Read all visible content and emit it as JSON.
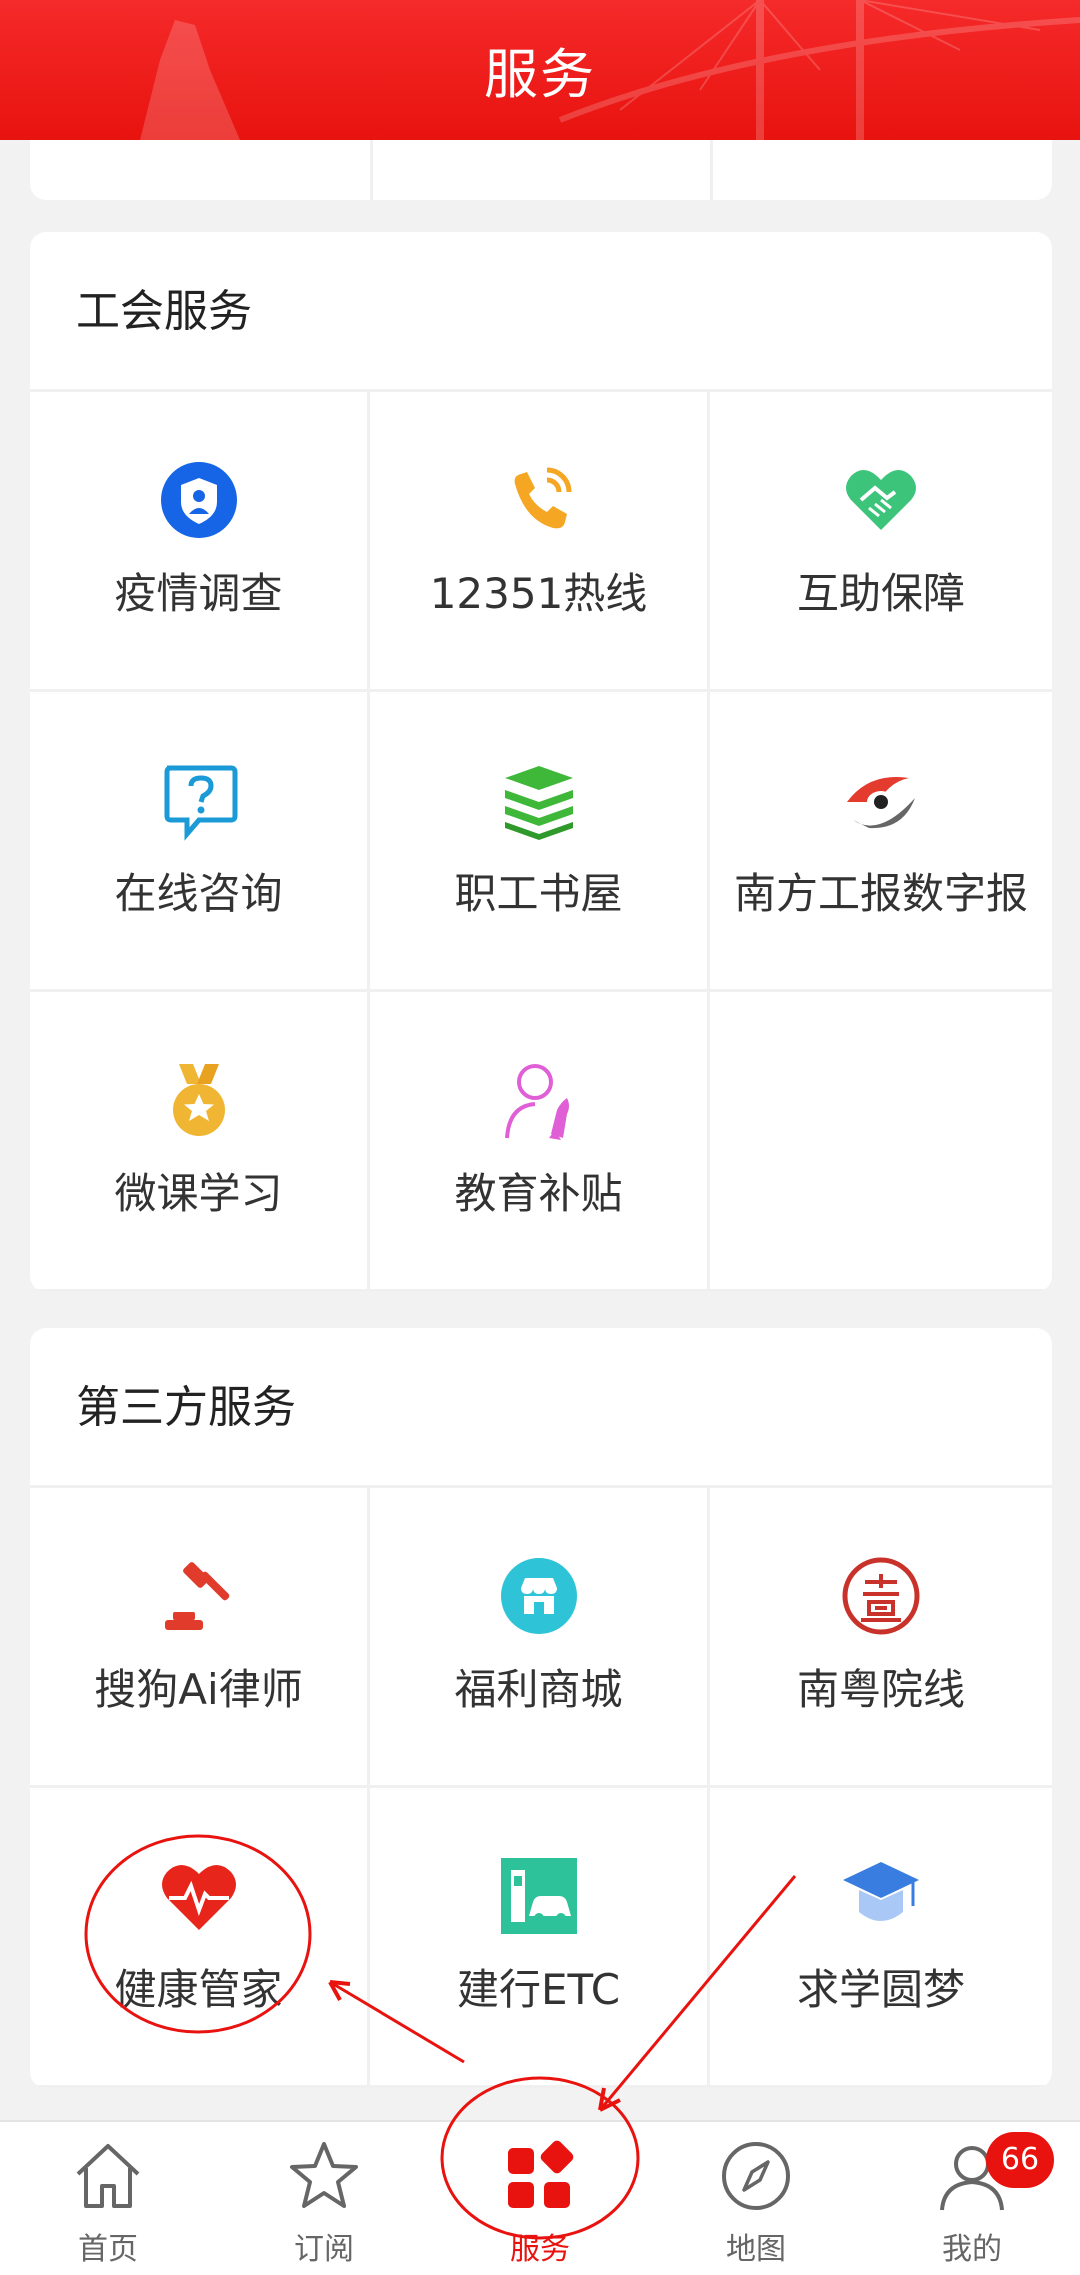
{
  "header": {
    "title": "服务"
  },
  "sections": [
    {
      "title": "工会服务",
      "items": [
        {
          "label": "疫情调查",
          "icon": "shield-person-icon"
        },
        {
          "label": "12351热线",
          "icon": "phone-hotline-icon"
        },
        {
          "label": "互助保障",
          "icon": "handshake-heart-icon"
        },
        {
          "label": "在线咨询",
          "icon": "question-bubble-icon"
        },
        {
          "label": "职工书屋",
          "icon": "book-stack-icon"
        },
        {
          "label": "南方工报数字报",
          "icon": "newspaper-logo-icon"
        },
        {
          "label": "微课学习",
          "icon": "medal-icon"
        },
        {
          "label": "教育补贴",
          "icon": "person-rocket-icon"
        }
      ]
    },
    {
      "title": "第三方服务",
      "items": [
        {
          "label": "搜狗Ai律师",
          "icon": "gavel-icon"
        },
        {
          "label": "福利商城",
          "icon": "store-icon"
        },
        {
          "label": "南粤院线",
          "icon": "seal-icon"
        },
        {
          "label": "健康管家",
          "icon": "heartbeat-icon"
        },
        {
          "label": "建行ETC",
          "icon": "etc-car-icon"
        },
        {
          "label": "求学圆梦",
          "icon": "graduation-cap-icon"
        }
      ]
    }
  ],
  "tabbar": {
    "tabs": [
      {
        "label": "首页",
        "icon": "home-icon"
      },
      {
        "label": "订阅",
        "icon": "star-icon"
      },
      {
        "label": "服务",
        "icon": "services-grid-icon"
      },
      {
        "label": "地图",
        "icon": "compass-icon"
      },
      {
        "label": "我的",
        "icon": "user-icon",
        "badge": "66"
      }
    ],
    "active": "服务"
  },
  "colors": {
    "accent": "#e8130f",
    "header_bg": "#f52a2a",
    "page_bg": "#f2f2f2"
  }
}
